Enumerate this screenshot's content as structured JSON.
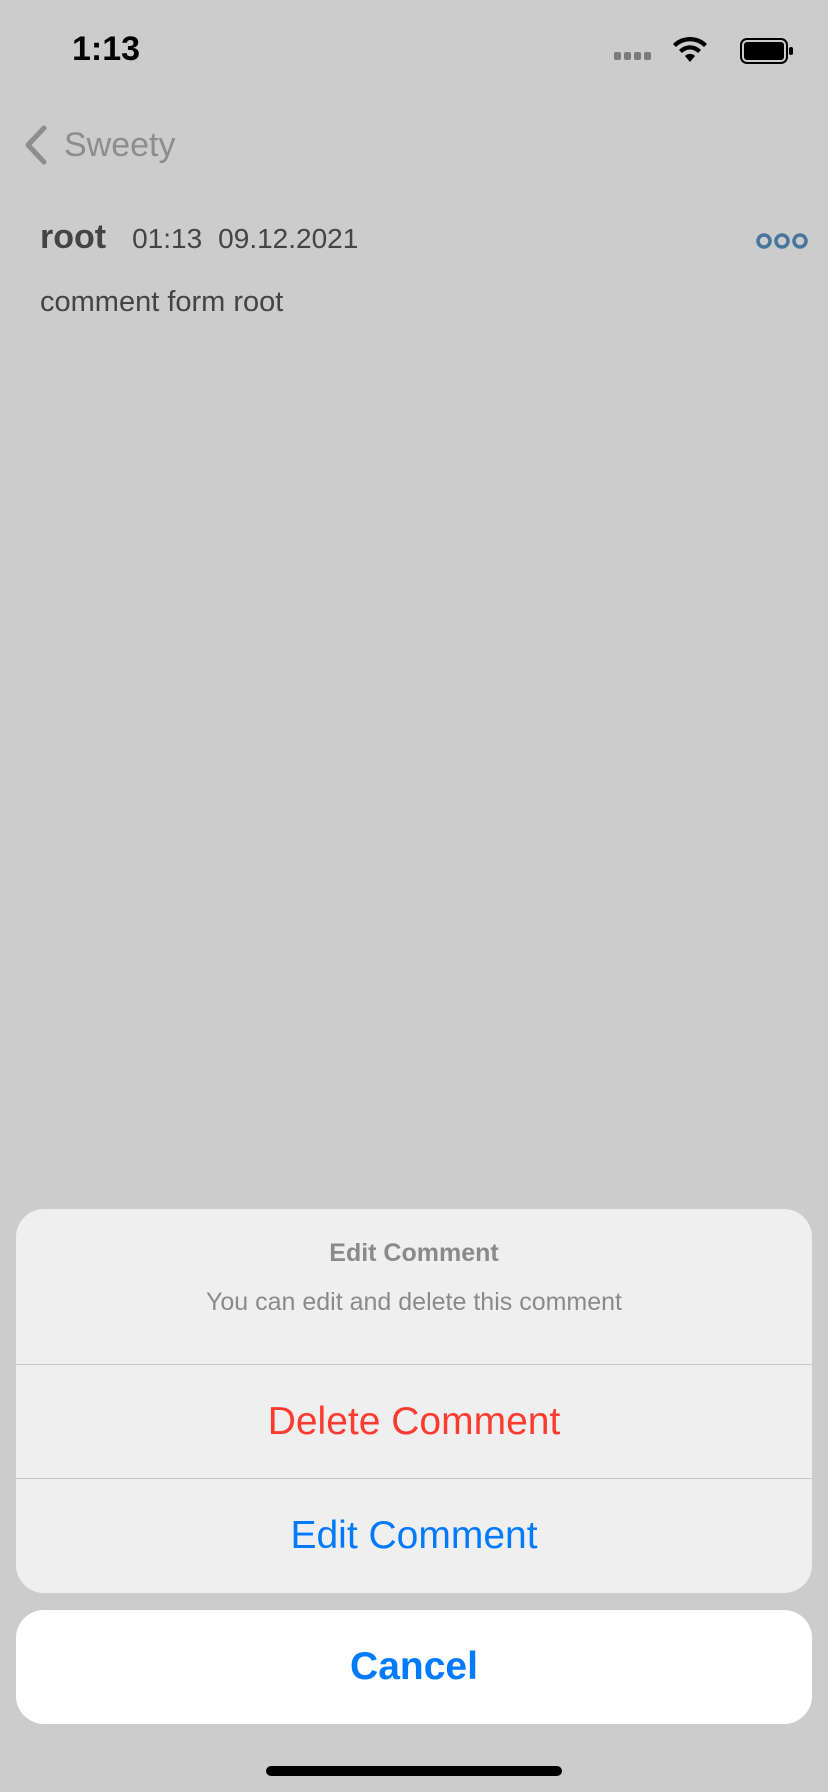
{
  "status_bar": {
    "time": "1:13",
    "icons": [
      "signal-icon",
      "wifi-icon",
      "battery-icon"
    ]
  },
  "nav": {
    "back_label": "Sweety",
    "back_icon": "chevron-left-icon",
    "accent": "#007aff"
  },
  "comment": {
    "author": "root",
    "time": "01:13",
    "date": "09.12.2021",
    "body": "comment form root",
    "more_icon": "more-dots-icon"
  },
  "action_sheet": {
    "title": "Edit Comment",
    "message": "You can edit and delete this comment",
    "actions": [
      {
        "label": "Delete Comment",
        "style": "destructive",
        "color": "#ff3b30"
      },
      {
        "label": "Edit Comment",
        "style": "default",
        "color": "#007aff"
      }
    ],
    "cancel_label": "Cancel"
  }
}
